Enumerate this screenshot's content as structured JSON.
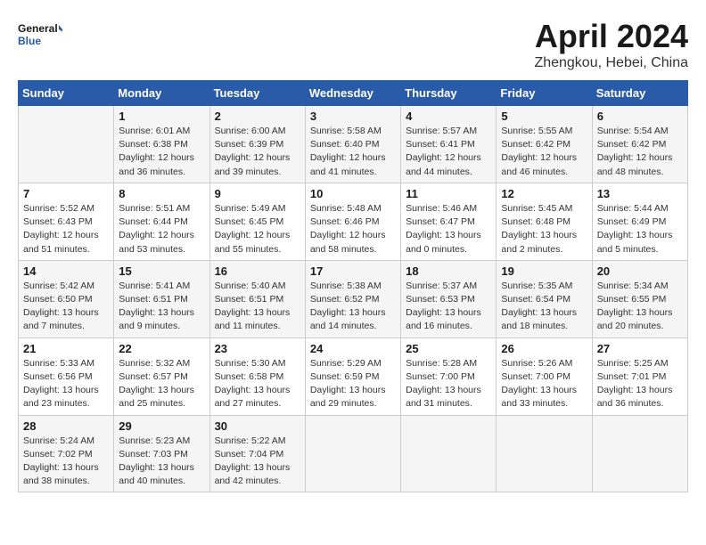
{
  "header": {
    "logo_line1": "General",
    "logo_line2": "Blue",
    "month_title": "April 2024",
    "location": "Zhengkou, Hebei, China"
  },
  "columns": [
    "Sunday",
    "Monday",
    "Tuesday",
    "Wednesday",
    "Thursday",
    "Friday",
    "Saturday"
  ],
  "weeks": [
    [
      {
        "day": "",
        "info": ""
      },
      {
        "day": "1",
        "info": "Sunrise: 6:01 AM\nSunset: 6:38 PM\nDaylight: 12 hours\nand 36 minutes."
      },
      {
        "day": "2",
        "info": "Sunrise: 6:00 AM\nSunset: 6:39 PM\nDaylight: 12 hours\nand 39 minutes."
      },
      {
        "day": "3",
        "info": "Sunrise: 5:58 AM\nSunset: 6:40 PM\nDaylight: 12 hours\nand 41 minutes."
      },
      {
        "day": "4",
        "info": "Sunrise: 5:57 AM\nSunset: 6:41 PM\nDaylight: 12 hours\nand 44 minutes."
      },
      {
        "day": "5",
        "info": "Sunrise: 5:55 AM\nSunset: 6:42 PM\nDaylight: 12 hours\nand 46 minutes."
      },
      {
        "day": "6",
        "info": "Sunrise: 5:54 AM\nSunset: 6:42 PM\nDaylight: 12 hours\nand 48 minutes."
      }
    ],
    [
      {
        "day": "7",
        "info": "Sunrise: 5:52 AM\nSunset: 6:43 PM\nDaylight: 12 hours\nand 51 minutes."
      },
      {
        "day": "8",
        "info": "Sunrise: 5:51 AM\nSunset: 6:44 PM\nDaylight: 12 hours\nand 53 minutes."
      },
      {
        "day": "9",
        "info": "Sunrise: 5:49 AM\nSunset: 6:45 PM\nDaylight: 12 hours\nand 55 minutes."
      },
      {
        "day": "10",
        "info": "Sunrise: 5:48 AM\nSunset: 6:46 PM\nDaylight: 12 hours\nand 58 minutes."
      },
      {
        "day": "11",
        "info": "Sunrise: 5:46 AM\nSunset: 6:47 PM\nDaylight: 13 hours\nand 0 minutes."
      },
      {
        "day": "12",
        "info": "Sunrise: 5:45 AM\nSunset: 6:48 PM\nDaylight: 13 hours\nand 2 minutes."
      },
      {
        "day": "13",
        "info": "Sunrise: 5:44 AM\nSunset: 6:49 PM\nDaylight: 13 hours\nand 5 minutes."
      }
    ],
    [
      {
        "day": "14",
        "info": "Sunrise: 5:42 AM\nSunset: 6:50 PM\nDaylight: 13 hours\nand 7 minutes."
      },
      {
        "day": "15",
        "info": "Sunrise: 5:41 AM\nSunset: 6:51 PM\nDaylight: 13 hours\nand 9 minutes."
      },
      {
        "day": "16",
        "info": "Sunrise: 5:40 AM\nSunset: 6:51 PM\nDaylight: 13 hours\nand 11 minutes."
      },
      {
        "day": "17",
        "info": "Sunrise: 5:38 AM\nSunset: 6:52 PM\nDaylight: 13 hours\nand 14 minutes."
      },
      {
        "day": "18",
        "info": "Sunrise: 5:37 AM\nSunset: 6:53 PM\nDaylight: 13 hours\nand 16 minutes."
      },
      {
        "day": "19",
        "info": "Sunrise: 5:35 AM\nSunset: 6:54 PM\nDaylight: 13 hours\nand 18 minutes."
      },
      {
        "day": "20",
        "info": "Sunrise: 5:34 AM\nSunset: 6:55 PM\nDaylight: 13 hours\nand 20 minutes."
      }
    ],
    [
      {
        "day": "21",
        "info": "Sunrise: 5:33 AM\nSunset: 6:56 PM\nDaylight: 13 hours\nand 23 minutes."
      },
      {
        "day": "22",
        "info": "Sunrise: 5:32 AM\nSunset: 6:57 PM\nDaylight: 13 hours\nand 25 minutes."
      },
      {
        "day": "23",
        "info": "Sunrise: 5:30 AM\nSunset: 6:58 PM\nDaylight: 13 hours\nand 27 minutes."
      },
      {
        "day": "24",
        "info": "Sunrise: 5:29 AM\nSunset: 6:59 PM\nDaylight: 13 hours\nand 29 minutes."
      },
      {
        "day": "25",
        "info": "Sunrise: 5:28 AM\nSunset: 7:00 PM\nDaylight: 13 hours\nand 31 minutes."
      },
      {
        "day": "26",
        "info": "Sunrise: 5:26 AM\nSunset: 7:00 PM\nDaylight: 13 hours\nand 33 minutes."
      },
      {
        "day": "27",
        "info": "Sunrise: 5:25 AM\nSunset: 7:01 PM\nDaylight: 13 hours\nand 36 minutes."
      }
    ],
    [
      {
        "day": "28",
        "info": "Sunrise: 5:24 AM\nSunset: 7:02 PM\nDaylight: 13 hours\nand 38 minutes."
      },
      {
        "day": "29",
        "info": "Sunrise: 5:23 AM\nSunset: 7:03 PM\nDaylight: 13 hours\nand 40 minutes."
      },
      {
        "day": "30",
        "info": "Sunrise: 5:22 AM\nSunset: 7:04 PM\nDaylight: 13 hours\nand 42 minutes."
      },
      {
        "day": "",
        "info": ""
      },
      {
        "day": "",
        "info": ""
      },
      {
        "day": "",
        "info": ""
      },
      {
        "day": "",
        "info": ""
      }
    ]
  ]
}
